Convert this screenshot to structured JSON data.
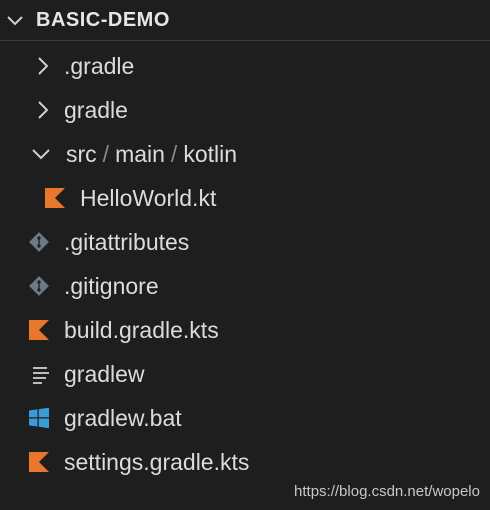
{
  "explorer": {
    "section_title": "BASIC-DEMO",
    "items": [
      {
        "label": ".gradle",
        "type": "folder",
        "expanded": false,
        "icon": "chevron-right-icon"
      },
      {
        "label": "gradle",
        "type": "folder",
        "expanded": false,
        "icon": "chevron-right-icon"
      },
      {
        "type": "folder",
        "expanded": true,
        "icon": "chevron-down-icon",
        "path": [
          "src",
          "main",
          "kotlin"
        ],
        "separator": "/"
      },
      {
        "label": "HelloWorld.kt",
        "type": "file",
        "icon": "kotlin-file-icon"
      },
      {
        "label": ".gitattributes",
        "type": "file",
        "icon": "git-file-icon"
      },
      {
        "label": ".gitignore",
        "type": "file",
        "icon": "git-file-icon"
      },
      {
        "label": "build.gradle.kts",
        "type": "file",
        "icon": "kotlin-file-icon"
      },
      {
        "label": "gradlew",
        "type": "file",
        "icon": "text-file-icon"
      },
      {
        "label": "gradlew.bat",
        "type": "file",
        "icon": "windows-file-icon"
      },
      {
        "label": "settings.gradle.kts",
        "type": "file",
        "icon": "kotlin-file-icon"
      }
    ]
  },
  "colors": {
    "background": "#1e1e1e",
    "kotlin_orange": "#e8762c",
    "git_gray": "#6b7a86",
    "windows_blue": "#3c9ad6",
    "header_border": "#2e3f52"
  },
  "watermark": "https://blog.csdn.net/wopelo"
}
